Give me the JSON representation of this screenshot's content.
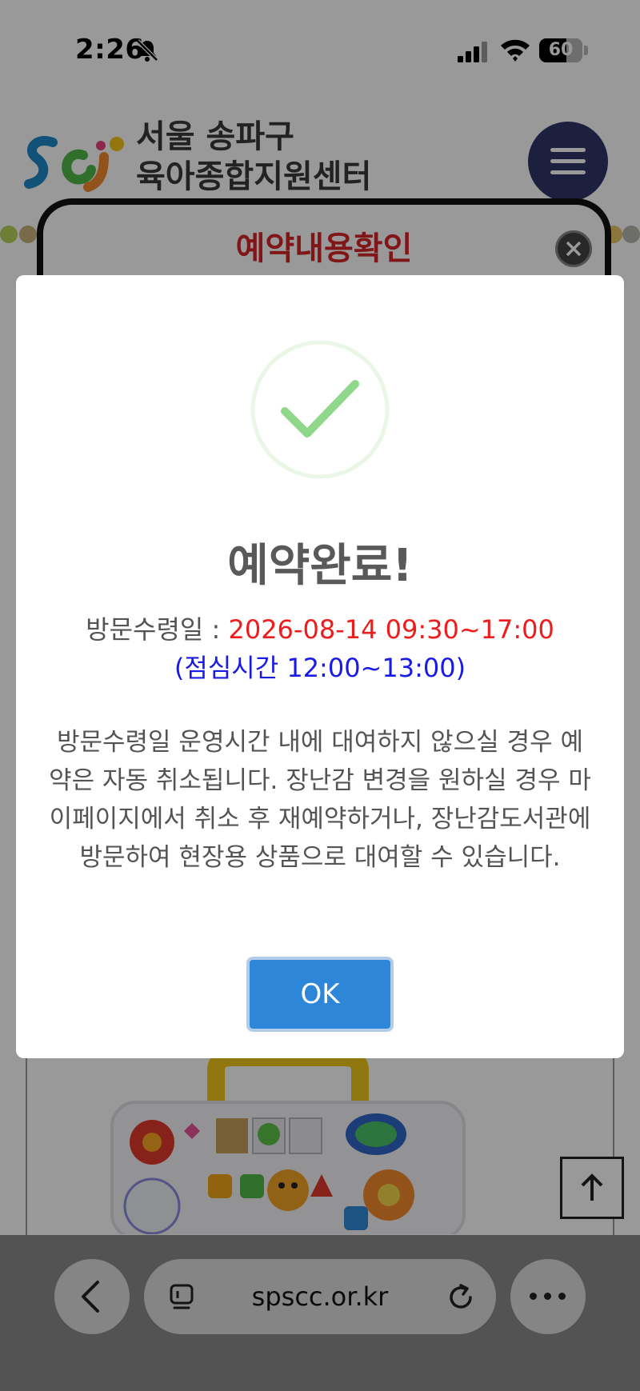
{
  "status_bar": {
    "time": "2:26",
    "battery": "60",
    "battery_level": 0.6
  },
  "site": {
    "name_line1": "서울 송파구",
    "name_line2": "육아종합지원센터"
  },
  "inner_modal": {
    "title": "예약내용확인"
  },
  "dialog": {
    "title": "예약완료!",
    "visit_label": "방문수령일 : ",
    "visit_value": "2026-08-14 09:30~17:00",
    "lunch_note": "(점심시간 12:00~13:00)",
    "notice": "방문수령일 운영시간 내에 대여하지 않으실 경우 예약은 자동 취소됩니다. 장난감 변경을 원하실 경우 마이페이지에서 취소 후 재예약하거나, 장난감도서관에 방문하여 현장용 상품으로 대여할 수 있습니다.",
    "ok_label": "OK"
  },
  "browser": {
    "url": "spscc.or.kr"
  },
  "icons": {
    "bell": "bell-slash-icon",
    "signal": "cellular-signal-icon",
    "wifi": "wifi-icon",
    "menu": "hamburger-menu-icon",
    "close": "close-icon",
    "success": "checkmark-circle-icon",
    "scroll_top": "arrow-up-icon",
    "back": "chevron-left-icon",
    "tabs": "tabs-icon",
    "reload": "reload-icon",
    "more": "more-dots-icon"
  },
  "colors": {
    "menu_button": "#2f3566",
    "inner_title": "#d8262a",
    "visit_value": "#ee1c1c",
    "lunch_note": "#1a1ae6",
    "ok_button": "#2e86d8",
    "success_check": "#8fd88a"
  }
}
